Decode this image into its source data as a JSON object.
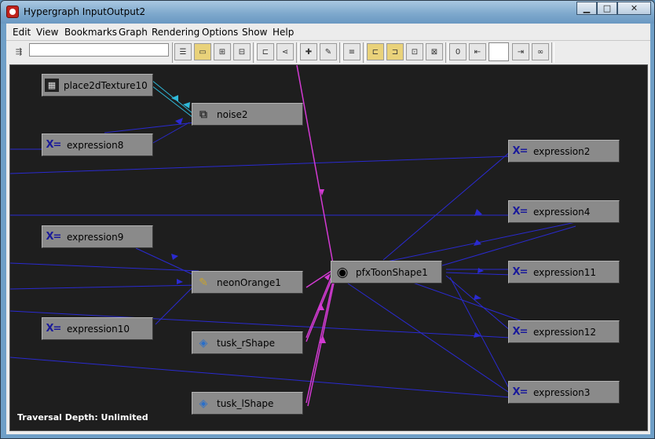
{
  "window": {
    "title": "Hypergraph InputOutput2"
  },
  "menu": [
    "Edit",
    "View",
    "Bookmarks",
    "Graph",
    "Rendering",
    "Options",
    "Show",
    "Help"
  ],
  "toolbar": {
    "search_value": "",
    "depth_value": ""
  },
  "nodes": {
    "place2dTexture10": "place2dTexture10",
    "noise2": "noise2",
    "expression8": "expression8",
    "expression9": "expression9",
    "neonOrange1": "neonOrange1",
    "expression10": "expression10",
    "tusk_rShape": "tusk_rShape",
    "tusk_lShape": "tusk_lShape",
    "pfxToonShape1": "pfxToonShape1",
    "expression2": "expression2",
    "expression4": "expression4",
    "expression11": "expression11",
    "expression12": "expression12",
    "expression3": "expression3"
  },
  "status": "Traversal Depth: Unlimited",
  "colors": {
    "canvas": "#1e1e1e",
    "node": "#8a8a8a",
    "wire_blue": "#2a2ad0",
    "wire_magenta": "#d23ad2",
    "wire_cyan": "#2fb8d8"
  }
}
